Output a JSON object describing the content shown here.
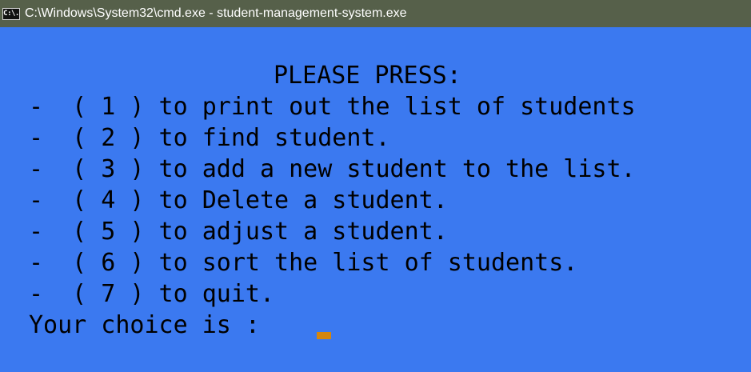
{
  "window": {
    "title": "C:\\Windows\\System32\\cmd.exe - student-management-system.exe",
    "icon": "cmd-prompt-icon",
    "icon_text": "C:\\."
  },
  "colors": {
    "console_background": "#3b79f0",
    "console_text": "#000000",
    "titlebar_background": "#56604a",
    "cursor": "#d4860f"
  },
  "console": {
    "heading": "PLEASE PRESS:",
    "options": [
      "-  ( 1 ) to print out the list of students",
      "-  ( 2 ) to find student.",
      "-  ( 3 ) to add a new student to the list.",
      "-  ( 4 ) to Delete a student.",
      "-  ( 5 ) to adjust a student.",
      "-  ( 6 ) to sort the list of students.",
      "-  ( 7 ) to quit."
    ],
    "prompt": "Your choice is :"
  }
}
